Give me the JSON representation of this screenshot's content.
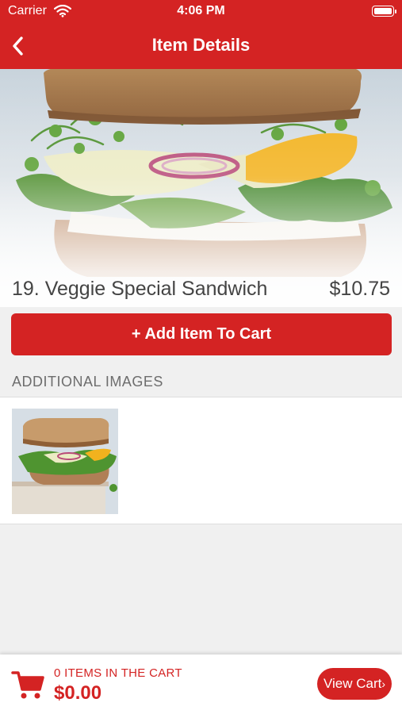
{
  "status_bar": {
    "carrier": "Carrier",
    "time": "4:06 PM"
  },
  "nav": {
    "title": "Item Details",
    "back_icon": "chevron-left-icon"
  },
  "item": {
    "name": "19. Veggie Special Sandwich",
    "price": "$10.75"
  },
  "actions": {
    "add_to_cart_label": "Add Item To Cart",
    "add_icon": "plus-icon"
  },
  "additional_images": {
    "title": "ADDITIONAL IMAGES",
    "count": 1
  },
  "cart": {
    "count_label": "0 ITEMS IN THE CART",
    "total": "$0.00",
    "view_cart_label": "View Cart",
    "view_cart_icon": "chevron-right-icon"
  },
  "colors": {
    "brand_red": "#d42323",
    "background": "#f0f0f0",
    "text_gray": "#444444"
  }
}
